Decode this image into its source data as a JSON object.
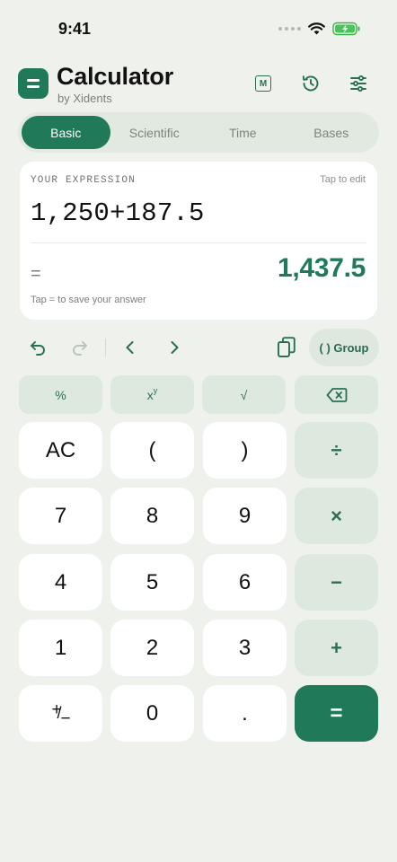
{
  "status_bar": {
    "time": "9:41"
  },
  "header": {
    "title": "Calculator",
    "subtitle": "by Xidents",
    "memory_label": "M"
  },
  "tabs": [
    {
      "label": "Basic",
      "active": true
    },
    {
      "label": "Scientific",
      "active": false
    },
    {
      "label": "Time",
      "active": false
    },
    {
      "label": "Bases",
      "active": false
    }
  ],
  "expression_card": {
    "label": "YOUR EXPRESSION",
    "edit_hint": "Tap to edit",
    "expression": "1,250+187.5",
    "equals_sign": "=",
    "result": "1,437.5",
    "save_hint": "Tap = to save your answer"
  },
  "toolbar": {
    "group_label": "( ) Group"
  },
  "keypad": {
    "percent": "%",
    "power_base": "x",
    "power_exp": "y",
    "sqrt": "√",
    "ac": "AC",
    "open_paren": "(",
    "close_paren": ")",
    "divide": "÷",
    "seven": "7",
    "eight": "8",
    "nine": "9",
    "multiply": "×",
    "four": "4",
    "five": "5",
    "six": "6",
    "minus": "−",
    "one": "1",
    "two": "2",
    "three": "3",
    "plus": "+",
    "sign_plus": "+",
    "sign_slash": "/",
    "sign_minus": "−",
    "zero": "0",
    "decimal": ".",
    "equals": "="
  },
  "colors": {
    "accent": "#207959",
    "background": "#eff2ec",
    "key_operator": "#dde8df"
  },
  "icons": [
    "memory-icon",
    "history-icon",
    "settings-sliders-icon",
    "undo-icon",
    "redo-icon",
    "cursor-left-icon",
    "cursor-right-icon",
    "copy-icon",
    "backspace-icon",
    "wifi-icon",
    "battery-charging-icon"
  ]
}
